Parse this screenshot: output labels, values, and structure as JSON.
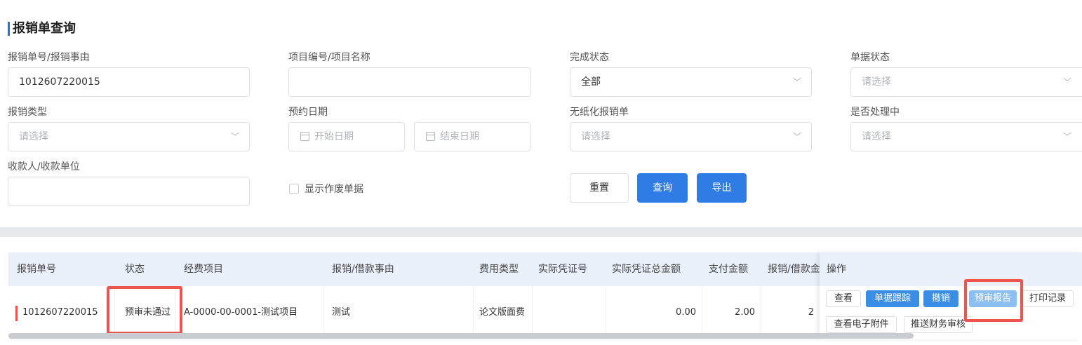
{
  "page_title": "报销单查询",
  "filters": {
    "reimb_no_label": "报销单号/报销事由",
    "reimb_no_value": "1012607220015",
    "project_label": "项目编号/项目名称",
    "project_value": "",
    "complete_status_label": "完成状态",
    "complete_status_value": "全部",
    "doc_status_label": "单据状态",
    "doc_status_placeholder": "请选择",
    "reimb_type_label": "报销类型",
    "reimb_type_placeholder": "请选择",
    "appointment_label": "预约日期",
    "start_date_placeholder": "开始日期",
    "end_date_placeholder": "结束日期",
    "paperless_label": "无纸化报销单",
    "paperless_placeholder": "请选择",
    "processing_label": "是否处理中",
    "processing_placeholder": "请选择",
    "payee_label": "收款人/收款单位",
    "payee_value": "",
    "show_void_label": "显示作废单据",
    "show_void_checked": false,
    "reset_label": "重置",
    "query_label": "查询",
    "export_label": "导出"
  },
  "table": {
    "headers": [
      "报销单号",
      "状态",
      "经费项目",
      "报销/借款事由",
      "费用类型",
      "实际凭证号",
      "实际凭证总金额",
      "支付金额",
      "报销/借款金"
    ],
    "ops_header": "操作",
    "rows": [
      {
        "reimb_no": "1012607220015",
        "status": "预审未通过",
        "project": "A-0000-00-0001-测试项目",
        "reason": "测试",
        "fee_type": "论文版面费",
        "voucher_no": "",
        "voucher_total": "0.00",
        "pay_amount": "2.00",
        "reimb_amount": "2",
        "ops": [
          "查看",
          "单据跟踪",
          "撤销",
          "预审报告",
          "打印记录",
          "查看电子附件",
          "推送财务审核"
        ]
      }
    ]
  },
  "colors": {
    "primary": "#2f7ce4",
    "highlight_red": "#ef5350",
    "header_bg": "#eaf1fb"
  }
}
